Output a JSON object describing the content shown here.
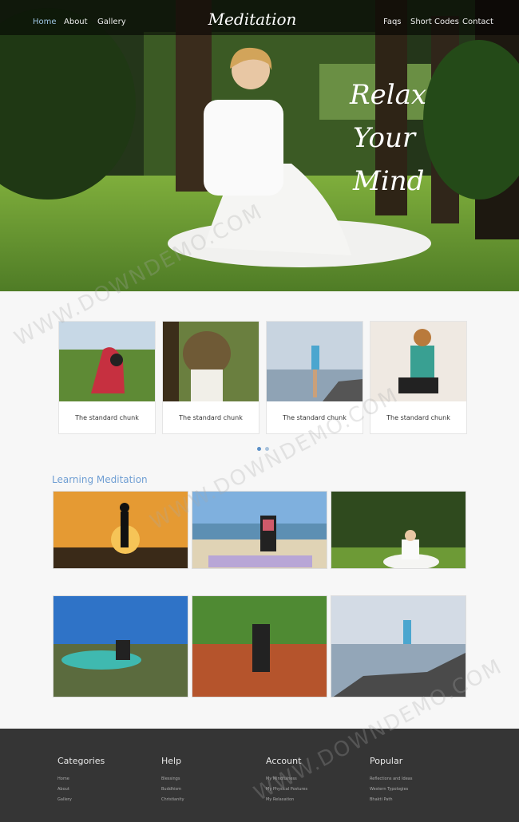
{
  "nav": {
    "left": [
      "Home",
      "About",
      "Gallery"
    ],
    "brand": "Meditation",
    "right": [
      "Faqs",
      "Short Codes",
      "Contact"
    ]
  },
  "hero": {
    "tagline": [
      "Relax",
      "Your",
      "Mind"
    ],
    "image": "woman meditating on grass in garden"
  },
  "carousel": {
    "cards": [
      {
        "caption": "The standard chunk",
        "image": "yoga backbend on hilltop"
      },
      {
        "caption": "The standard chunk",
        "image": "forward bend under tree"
      },
      {
        "caption": "The standard chunk",
        "image": "tree pose by lake"
      },
      {
        "caption": "The standard chunk",
        "image": "tree pose in room"
      }
    ],
    "dots": 2,
    "active_dot": 0
  },
  "learning": {
    "title": "Learning Meditation",
    "images": [
      "silhouette at sunset",
      "woman seated on beach mat",
      "woman meditating in garden",
      "woman seated above crater lake",
      "woman bending in river",
      "tree pose on rocks by sea"
    ]
  },
  "footer": {
    "columns": [
      {
        "title": "Categories",
        "links": [
          "Home",
          "About",
          "Gallery"
        ]
      },
      {
        "title": "Help",
        "links": [
          "Blessings",
          "Buddhism",
          "Christianity"
        ]
      },
      {
        "title": "Account",
        "links": [
          "My Mindfulness",
          "My Physical Postures",
          "My Relaxation"
        ]
      },
      {
        "title": "Popular",
        "links": [
          "Reflections and Ideas",
          "Western Typologies",
          "Bhakti Path"
        ]
      }
    ]
  },
  "colors": {
    "accent": "#6f9ed3",
    "footer_bg": "#353535",
    "dot_active": "#5b8fc7",
    "dot_inactive": "#a9c3dc"
  },
  "watermark": "WWW.DOWNDEMO.COM"
}
